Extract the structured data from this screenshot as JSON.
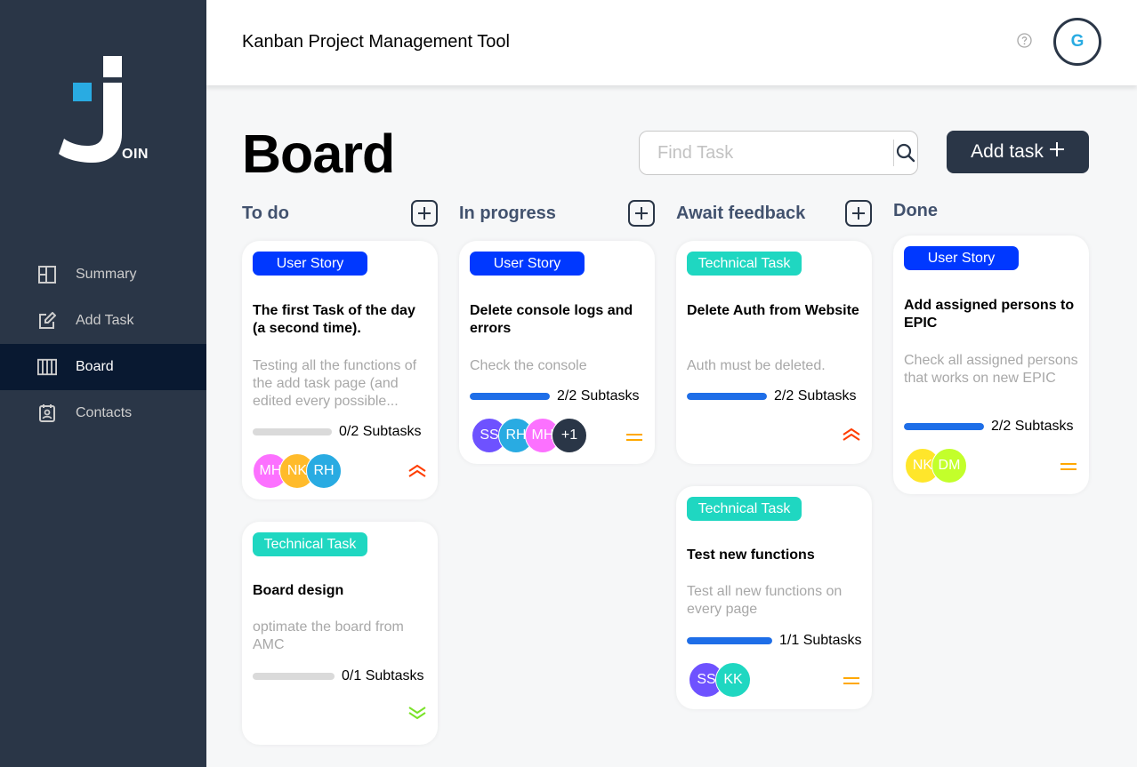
{
  "app": {
    "header_title": "Kanban Project Management Tool",
    "user_initial": "G",
    "logo_text": "OIN"
  },
  "nav": {
    "items": [
      {
        "label": "Summary",
        "icon": "summary-icon"
      },
      {
        "label": "Add Task",
        "icon": "add-task-icon"
      },
      {
        "label": "Board",
        "icon": "board-icon",
        "active": true
      },
      {
        "label": "Contacts",
        "icon": "contacts-icon"
      }
    ]
  },
  "board": {
    "title": "Board",
    "search_placeholder": "Find Task",
    "add_task_label": "Add task",
    "columns": [
      {
        "title": "To do"
      },
      {
        "title": "In progress"
      },
      {
        "title": "Await feedback"
      },
      {
        "title": "Done"
      }
    ]
  },
  "cards": {
    "todo1": {
      "tag": "User Story",
      "title": "The first Task of the day (a second time).",
      "desc": "Testing all the functions of the add task page (and edited every possible...",
      "subtasks": "0/2 Subtasks",
      "progress": 0,
      "avatars": [
        "MH",
        "NK",
        "RH"
      ],
      "priority": "urgent"
    },
    "todo2": {
      "tag": "Technical Task",
      "title": "Board design",
      "desc": "optimate the board from AMC",
      "subtasks": "0/1 Subtasks",
      "progress": 0,
      "priority": "low"
    },
    "prog1": {
      "tag": "User Story",
      "title": "Delete console logs and errors",
      "desc": "Check the console",
      "subtasks": "2/2 Subtasks",
      "progress": 1,
      "avatars": [
        "SS",
        "RH",
        "MH",
        "+1"
      ],
      "priority": "medium"
    },
    "await1": {
      "tag": "Technical Task",
      "title": "Delete Auth from Website",
      "desc": "Auth must be deleted.",
      "subtasks": "2/2 Subtasks",
      "progress": 1,
      "priority": "urgent"
    },
    "await2": {
      "tag": "Technical Task",
      "title": "Test new functions",
      "desc": "Test all new functions on every page",
      "subtasks": "1/1 Subtasks",
      "progress": 1,
      "avatars": [
        "SS",
        "KK"
      ],
      "priority": "medium"
    },
    "done1": {
      "tag": "User Story",
      "title": "Add assigned persons to EPIC",
      "desc": "Check all assigned persons that works on new EPIC",
      "subtasks": "2/2 Subtasks",
      "progress": 1,
      "avatars": [
        "NK",
        "DM"
      ],
      "priority": "medium"
    }
  },
  "colors": {
    "sidebar": "#2a3647",
    "user_story": "#0038ff",
    "technical_task": "#1fd7c1",
    "progress": "#1e6ee8",
    "urgent": "#ff3d00",
    "medium": "#ffa800",
    "low": "#7ae229"
  }
}
